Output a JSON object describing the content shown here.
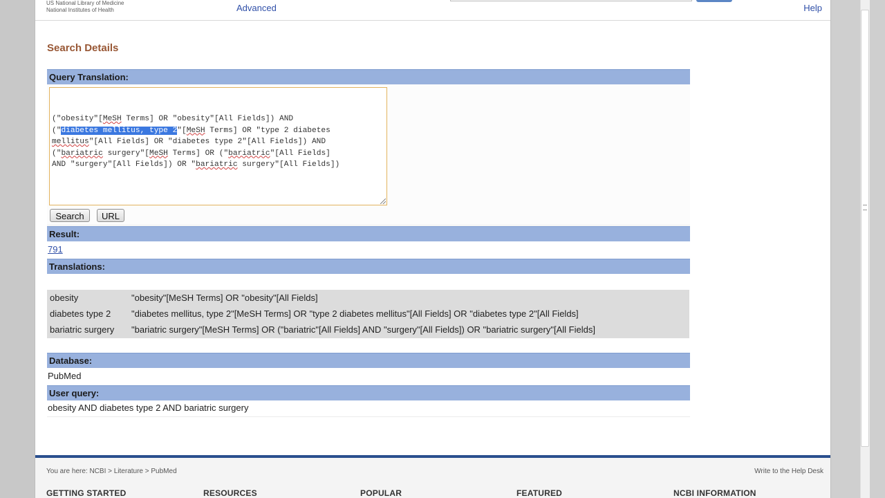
{
  "header": {
    "nlm_line1": "US National Library of Medicine",
    "nlm_line2": "National Institutes of Health",
    "advanced_label": "Advanced",
    "help_label": "Help"
  },
  "section_title": "Search Details",
  "query_translation": {
    "heading": "Query Translation:",
    "lines": [
      [
        "(\"obesity\"[",
        {
          "t": "MeSH",
          "u": true
        },
        " Terms] OR \"obesity\"[All Fields]) AND"
      ],
      [
        "(\"",
        {
          "t": "diabetes mellitus, type 2",
          "sel": true
        },
        "\"[",
        {
          "t": "MeSH",
          "u": true
        },
        " Terms] OR \"type 2 diabetes"
      ],
      [
        {
          "t": "mellitus",
          "u": true
        },
        "\"[All Fields] OR \"diabetes type 2\"[All Fields]) AND"
      ],
      [
        "(\"",
        {
          "t": "bariatric",
          "u": true
        },
        " surgery\"[",
        {
          "t": "MeSH",
          "u": true
        },
        " Terms] OR (\"",
        {
          "t": "bariatric",
          "u": true
        },
        "\"[All Fields]"
      ],
      [
        "AND \"surgery\"[All Fields]) OR \"",
        {
          "t": "bariatric",
          "u": true
        },
        " surgery\"[All Fields])"
      ]
    ],
    "search_button": "Search",
    "url_button": "URL"
  },
  "result": {
    "heading": "Result:",
    "count": "791"
  },
  "translations": {
    "heading": "Translations:",
    "rows": [
      {
        "term": "obesity",
        "translation": "\"obesity\"[MeSH Terms] OR \"obesity\"[All Fields]"
      },
      {
        "term": "diabetes type 2",
        "translation": "\"diabetes mellitus, type 2\"[MeSH Terms] OR \"type 2 diabetes mellitus\"[All Fields] OR \"diabetes type 2\"[All Fields]"
      },
      {
        "term": "bariatric surgery",
        "translation": "\"bariatric surgery\"[MeSH Terms] OR (\"bariatric\"[All Fields] AND \"surgery\"[All Fields]) OR \"bariatric surgery\"[All Fields]"
      }
    ]
  },
  "database": {
    "heading": "Database:",
    "value": "PubMed"
  },
  "user_query": {
    "heading": "User query:",
    "value": "obesity AND diabetes type 2 AND bariatric surgery"
  },
  "footer": {
    "breadcrumb": "You are here: NCBI > Literature > PubMed",
    "write_help": "Write to the Help Desk",
    "columns": [
      "GETTING STARTED",
      "RESOURCES",
      "POPULAR",
      "FEATURED",
      "NCBI INFORMATION"
    ]
  },
  "colors": {
    "bar": "#98b1dd",
    "title": "#985735",
    "link": "#2f4fa8",
    "footer_rule": "#2a4f8e",
    "selection": "#3b78e0"
  }
}
